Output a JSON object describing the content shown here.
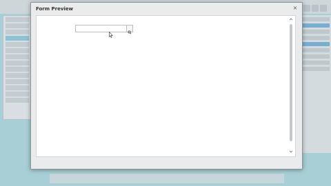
{
  "dialog": {
    "title": "Form Preview",
    "close_symbol": "×"
  },
  "search": {
    "value": "",
    "placeholder": ""
  },
  "icons": {
    "close": "close-icon",
    "search": "search-icon",
    "scroll_up": "chevron-up-icon",
    "scroll_down": "chevron-down-icon",
    "cursor": "mouse-cursor-icon"
  },
  "colors": {
    "backdrop": "#a8cfd6",
    "dialog_frame": "#e9ebec",
    "dialog_body": "#ffffff"
  }
}
